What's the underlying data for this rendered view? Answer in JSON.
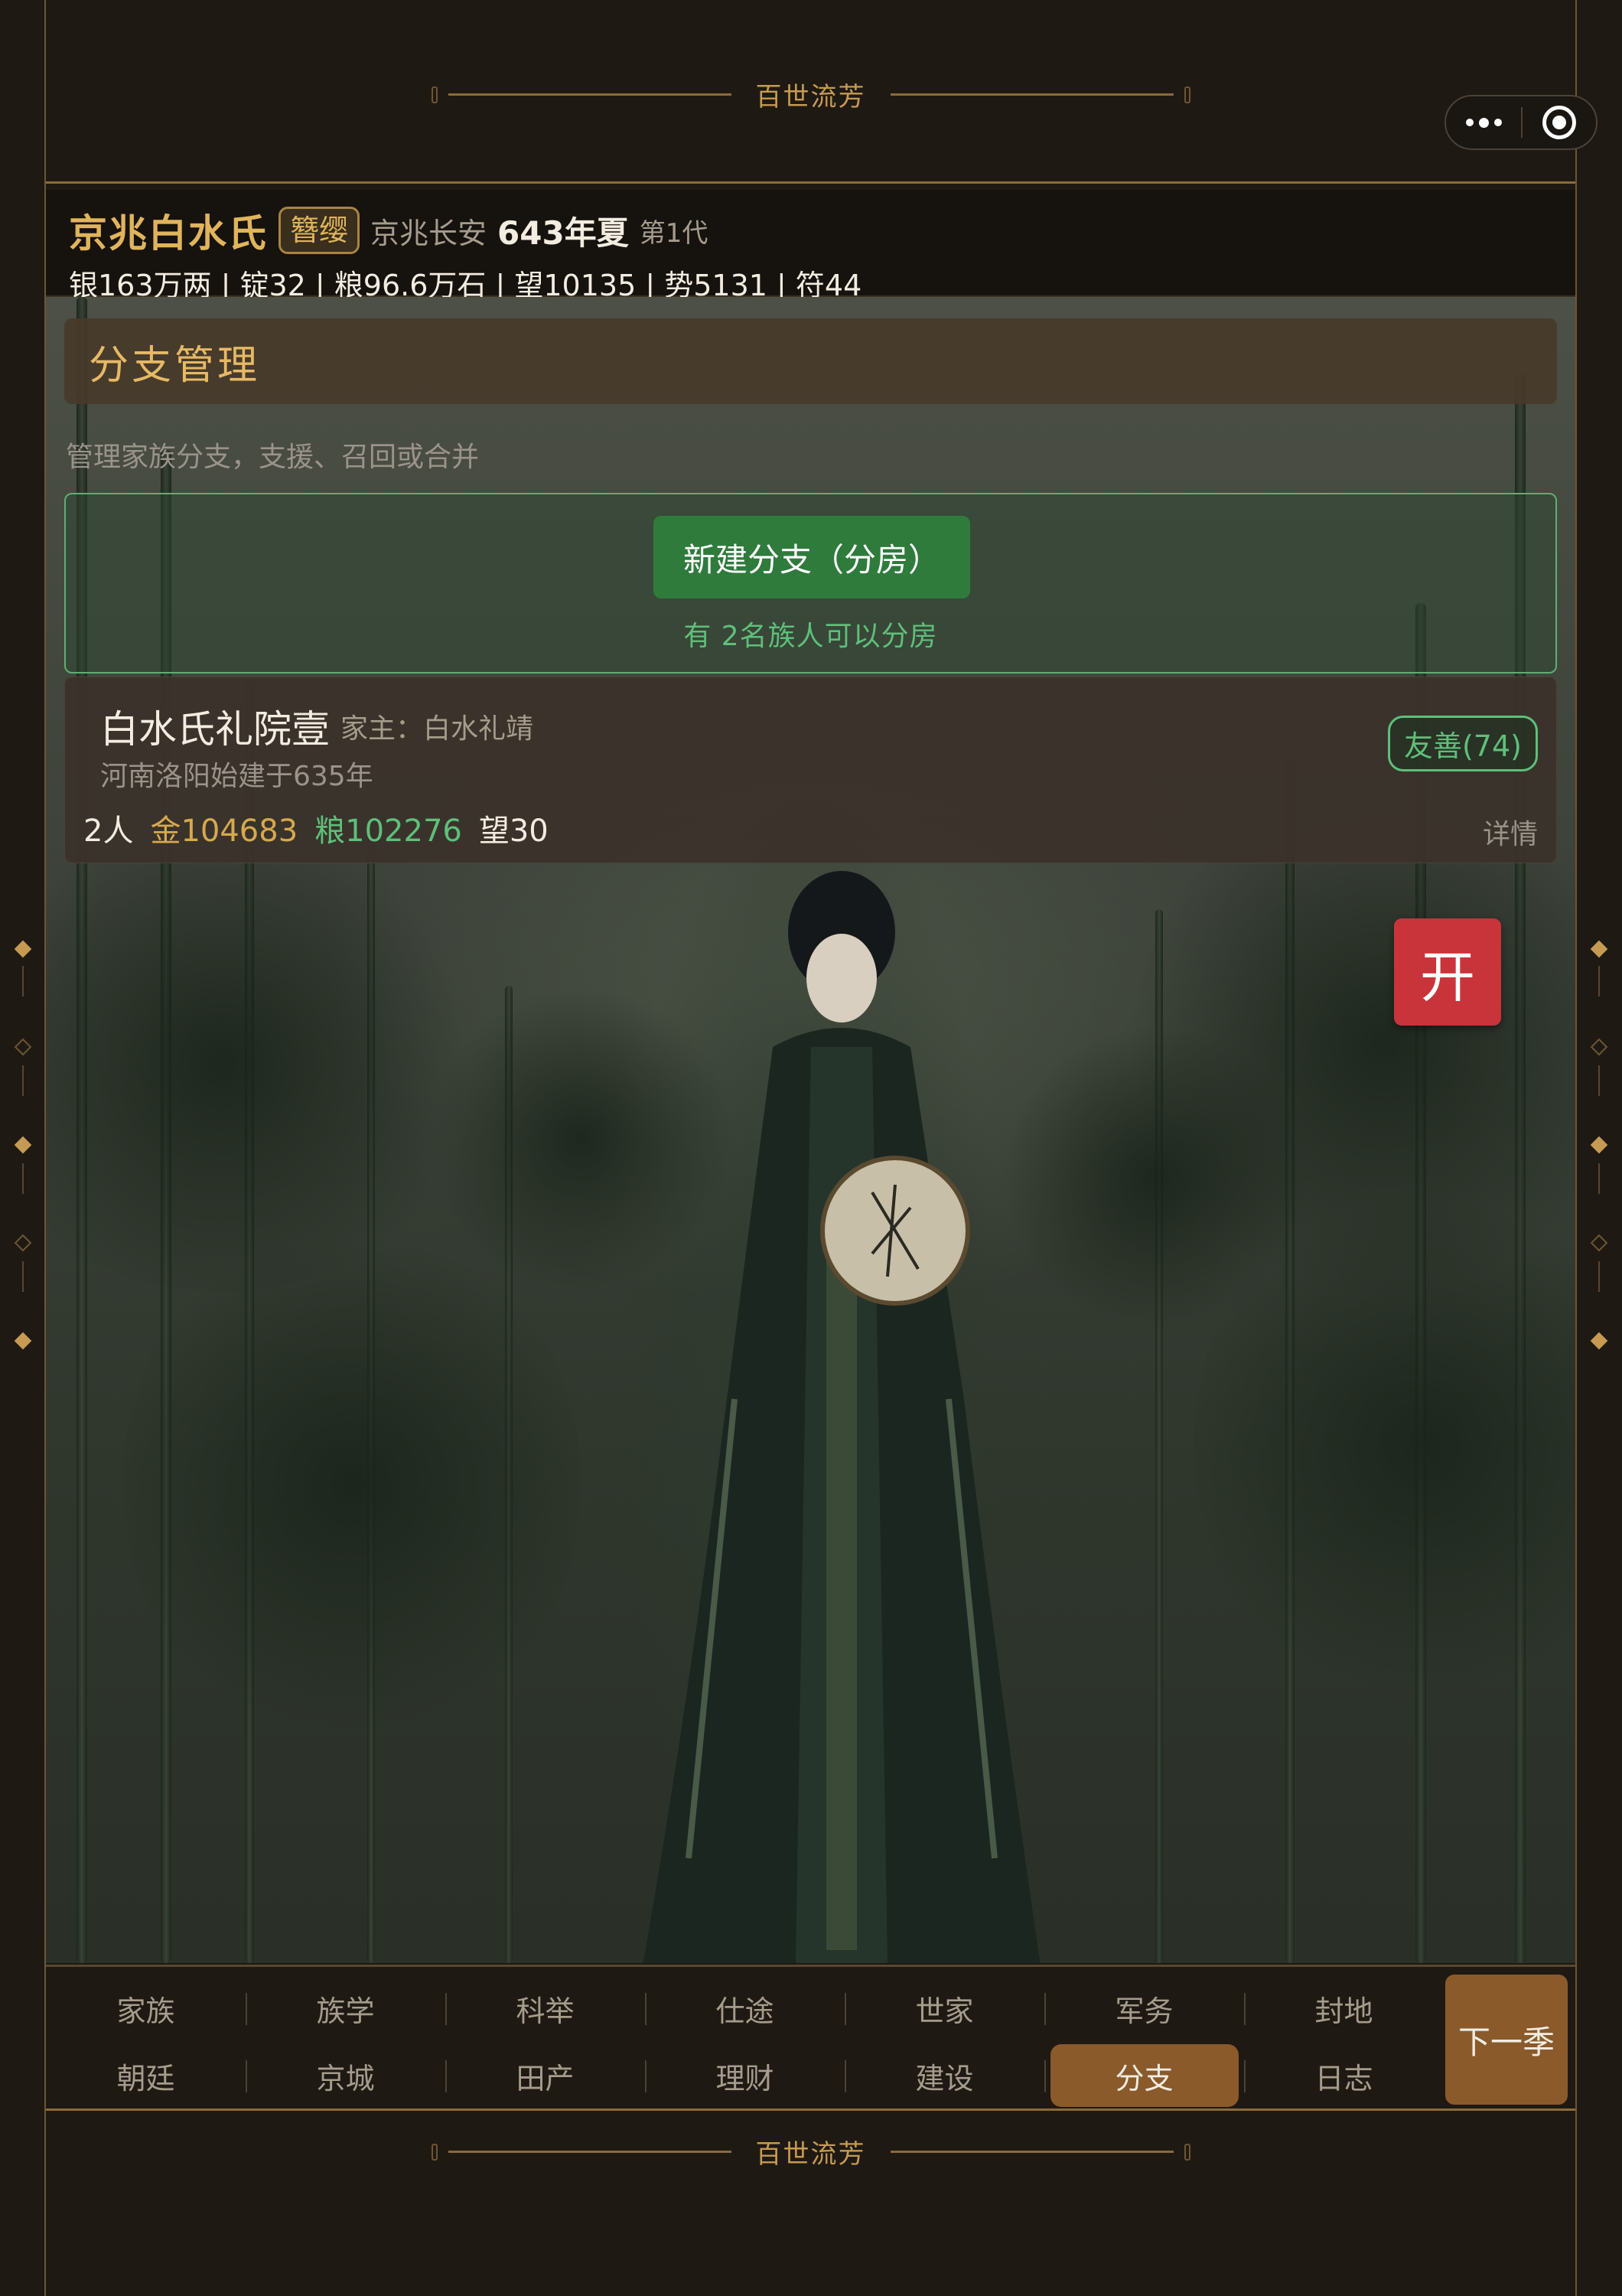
{
  "banner": {
    "top_text": "百世流芳",
    "bottom_text": "百世流芳"
  },
  "header": {
    "clan_name": "京兆白水氏",
    "rank": "簪缨",
    "location": "京兆长安",
    "date": "643年夏",
    "generation": "第1代",
    "resources": "银163万两 | 锭32 | 粮96.6万石 | 望10135 | 势5131 | 符44"
  },
  "page": {
    "title": "分支管理",
    "subtitle": "管理家族分支，支援、召回或合并"
  },
  "new_branch": {
    "button_label": "新建分支（分房）",
    "hint": "有 2名族人可以分房"
  },
  "branches": [
    {
      "name": "白水氏礼院壹",
      "head": "家主：白水礼靖",
      "location": "河南洛阳始建于635年",
      "people": "2人",
      "gold": "金104683",
      "grain": "粮102276",
      "fame": "望30",
      "attitude": "友善(74)",
      "detail_label": "详情"
    }
  ],
  "open_button": "开",
  "nav": {
    "row1": [
      "家族",
      "族学",
      "科举",
      "仕途",
      "世家",
      "军务",
      "封地"
    ],
    "row2": [
      "朝廷",
      "京城",
      "田产",
      "理财",
      "建设",
      "分支",
      "日志"
    ],
    "active": "分支",
    "next_label": "下一季"
  },
  "colors": {
    "accent_gold": "#e0b45c",
    "positive_green": "#5fbf7a",
    "active_tab": "#8a5a2b",
    "open_red": "#c8343a"
  },
  "icons": [
    "more-icon",
    "close-capsule-icon",
    "diamond-ornament-icon"
  ]
}
